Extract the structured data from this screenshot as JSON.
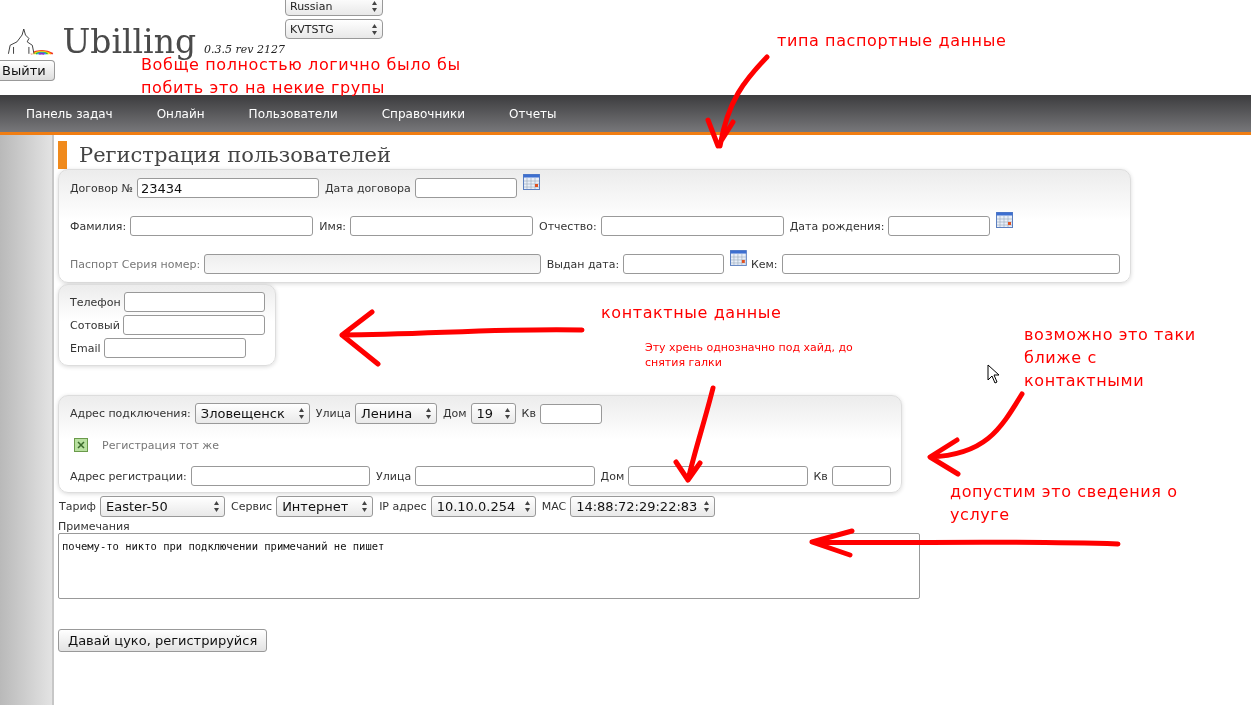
{
  "header": {
    "language": "Russian",
    "database": "KVTSTG",
    "logo_text": "Ubilling",
    "version": "0.3.5 rev 2127",
    "logout_button": "Выйти"
  },
  "nav": [
    {
      "label": "Панель задач"
    },
    {
      "label": "Онлайн"
    },
    {
      "label": "Пользователи"
    },
    {
      "label": "Справочники"
    },
    {
      "label": "Отчеты"
    }
  ],
  "page_title": "Регистрация пользователей",
  "personal_rows": [
    [
      {
        "label": "Договор №",
        "value": "23434",
        "calendar": false,
        "disabled": false
      },
      {
        "label": "Дата договора",
        "calendar": true,
        "disabled": false
      }
    ],
    [
      {
        "label": "Фамилия:",
        "calendar": false,
        "disabled": false
      },
      {
        "label": "Имя:",
        "calendar": false,
        "disabled": false
      },
      {
        "label": "Отчество:",
        "calendar": false,
        "disabled": false
      },
      {
        "label": "Дата рождения:",
        "calendar": true,
        "disabled": false
      }
    ],
    [
      {
        "label": "Паспорт Серия номер:",
        "calendar": false,
        "disabled": true
      },
      {
        "label": "Выдан дата:",
        "calendar": true,
        "disabled": false
      },
      {
        "label": "Кем:",
        "calendar": false,
        "disabled": false
      }
    ]
  ],
  "contacts": [
    {
      "label": "Телефон"
    },
    {
      "label": "Сотовый"
    },
    {
      "label": "Email"
    }
  ],
  "connection_address": [
    {
      "label": "Адрес подключения:",
      "value": "Зловещенск",
      "kind": "select"
    },
    {
      "label": "Улица",
      "value": "Ленина",
      "kind": "select"
    },
    {
      "label": "Дом",
      "value": "19",
      "kind": "select"
    },
    {
      "label": "Кв",
      "kind": "input"
    }
  ],
  "same_registration": {
    "label": "Регистрация тот же",
    "checked": true
  },
  "registration_address": [
    {
      "label": "Адрес регистрации:"
    },
    {
      "label": "Улица"
    },
    {
      "label": "Дом"
    },
    {
      "label": "Кв"
    }
  ],
  "service": [
    {
      "label": "Тариф",
      "value": "Easter-50"
    },
    {
      "label": "Сервис",
      "value": "Интернет"
    },
    {
      "label": "IP адрес",
      "value": "10.10.0.254"
    },
    {
      "label": "MAC",
      "value": "14:88:72:29:22:83"
    }
  ],
  "notes": {
    "label": "Примечания",
    "value": "почему-то никто при подключении примечаний не пишет"
  },
  "submit_button": "Давай цуко, регистрируйся",
  "annotations": [
    {
      "text": "Вобще полностью логично было бы побить это на некие групы",
      "kind": "large"
    },
    {
      "text": "типа паспортные данные",
      "kind": "large"
    },
    {
      "text": "контактные данные",
      "kind": "large"
    },
    {
      "text": "Эту хрень однозначно под хайд, до снятия галки",
      "kind": "small"
    },
    {
      "text": "возможно это таки ближе с контактными",
      "kind": "large"
    },
    {
      "text": "допустим это сведения о услуге",
      "kind": "large"
    }
  ]
}
